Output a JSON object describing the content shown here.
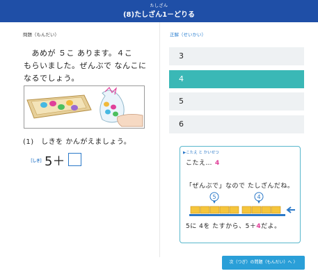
{
  "header": {
    "ruby": "たしざん",
    "title": "(8)たしざん1－どりる"
  },
  "left": {
    "section_label": "問題（もんだい）",
    "question_line1": "　あめが ５こ あります。４こ",
    "question_line2": "もらいました。ぜんぶで なんこに",
    "question_line3": "なるでしょう。",
    "prompt": "(1)　しきを かんがえましょう。",
    "siki_label": "しき",
    "expression": "5＋"
  },
  "right": {
    "section_label": "正解（せいかい）",
    "choices": [
      "3",
      "4",
      "5",
      "6"
    ],
    "selected_index": 1
  },
  "explanation": {
    "header": "▶こたえ と かいせつ",
    "answer_prefix": "こたえ…",
    "answer_value": "4",
    "line1": "「ぜんぶで」なので たしざんだね。",
    "marker_left": "5",
    "marker_right": "4",
    "line2_a": "5に 4を たすから、5＋",
    "line2_num": "4",
    "line2_b": "だよ。"
  },
  "next_button": {
    "label": "次（つぎ）の問題（もんだい）へ"
  },
  "colors": {
    "header": "#1f4fa7",
    "selected": "#3ab8b6",
    "button": "#2a9fd8",
    "pink": "#e0409a",
    "blue": "#2a78c8"
  }
}
